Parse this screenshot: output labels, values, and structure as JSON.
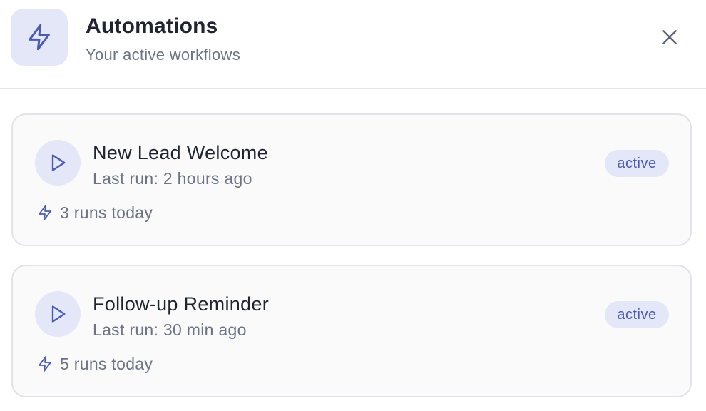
{
  "panel": {
    "icon": "lightning-icon",
    "title": "Automations",
    "subtitle": "Your active workflows",
    "close_icon": "close-icon"
  },
  "workflows": [
    {
      "name": "New Lead Welcome",
      "last_run": "Last run: 2 hours ago",
      "status": "active",
      "runs": "3 runs today"
    },
    {
      "name": "Follow-up Reminder",
      "last_run": "Last run: 30 min ago",
      "status": "active",
      "runs": "5 runs today"
    }
  ],
  "colors": {
    "accent": "#4a5bb5",
    "accent_bg": "#e3e7f7",
    "muted_text": "#6b7385",
    "card_bg": "#fafafa",
    "border": "#e1e3e8"
  }
}
